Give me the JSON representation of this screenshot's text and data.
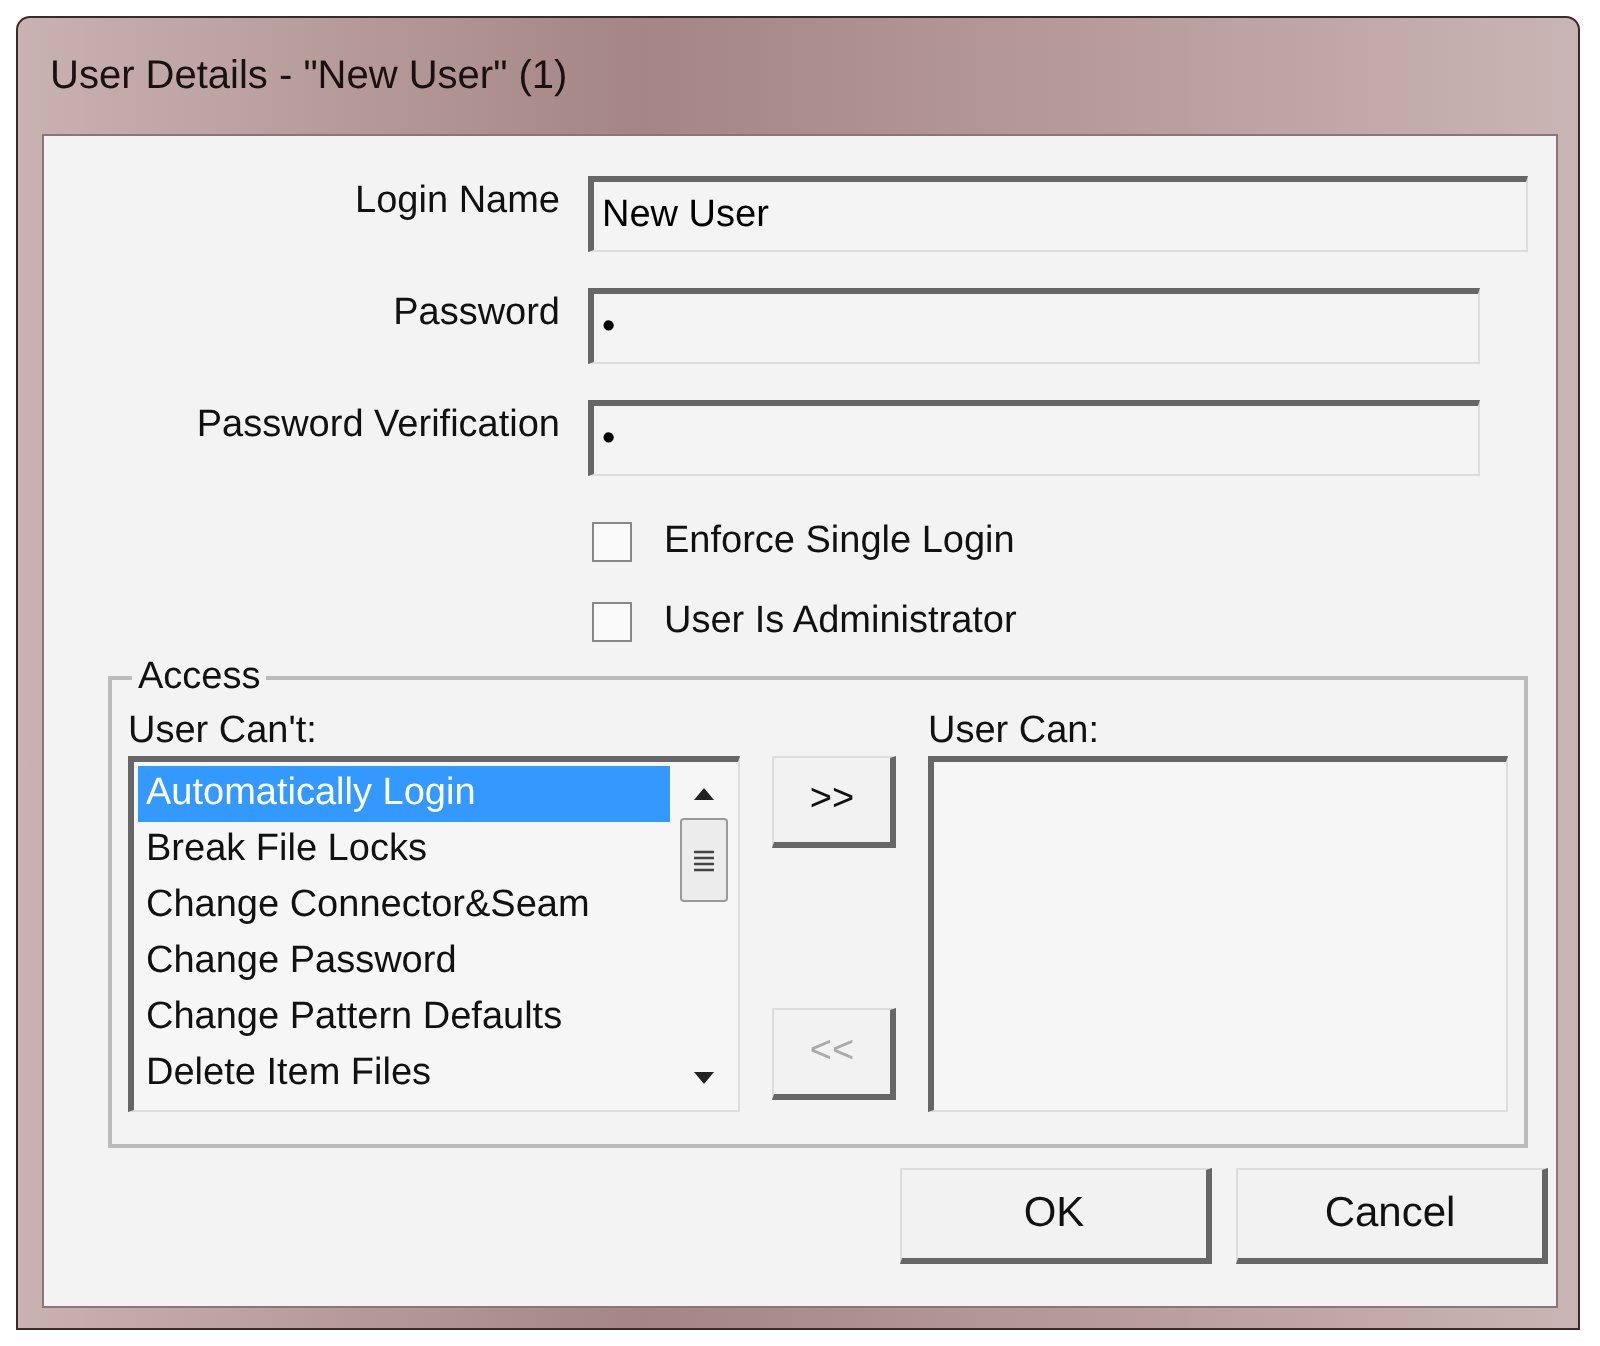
{
  "window": {
    "title": "User Details - \"New User\" (1)"
  },
  "fields": [
    {
      "label": "Login Name",
      "value": "New User"
    },
    {
      "label": "Password",
      "value": "•"
    },
    {
      "label": "Password Verification",
      "value": "•"
    }
  ],
  "checkboxes": [
    {
      "label": "Enforce Single Login",
      "checked": false
    },
    {
      "label": "User Is Administrator",
      "checked": false
    }
  ],
  "access": {
    "title": "Access",
    "cant_label": "User Can't:",
    "can_label": "User Can:",
    "cant_items": [
      {
        "label": "Automatically Login",
        "selected": true
      },
      {
        "label": "Break File Locks",
        "selected": false
      },
      {
        "label": "Change Connector&Seam",
        "selected": false
      },
      {
        "label": "Change Password",
        "selected": false
      },
      {
        "label": "Change Pattern Defaults",
        "selected": false
      },
      {
        "label": "Delete Item Files",
        "selected": false
      }
    ],
    "move_buttons": [
      {
        "label": ">>",
        "disabled": false
      },
      {
        "label": "<<",
        "disabled": true
      }
    ]
  },
  "buttons": [
    "OK",
    "Cancel"
  ]
}
